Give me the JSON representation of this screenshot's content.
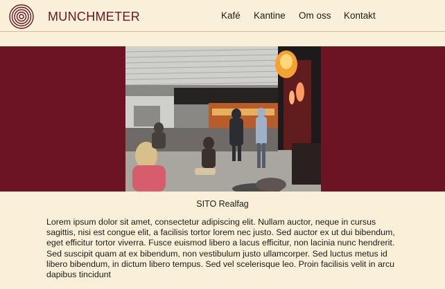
{
  "header": {
    "logo_icon": "concentric-circles-logo",
    "brand": "MUNCHMETER",
    "nav": [
      "Kafé",
      "Kantine",
      "Om oss",
      "Kontakt"
    ]
  },
  "hero": {
    "image_icon": "cafeteria-photo"
  },
  "content": {
    "caption": "SITO Realfag",
    "paragraph": "Lorem ipsum dolor sit amet, consectetur adipiscing elit. Nullam auctor, neque in cursus sagittis, nisi est congue elit, a facilisis tortor lorem nec justo. Sed auctor ex ut dui bibendum, eget efficitur tortor viverra. Fusce euismod libero a lacus efficitur, non lacinia nunc hendrerit. Sed suscipit quam at ex bibendum, non vestibulum justo ullamcorper. Sed luctus metus id libero bibendum, in dictum libero tempus. Sed vel scelerisque leo. Proin facilisis velit in arcu dapibus tincidunt"
  },
  "colors": {
    "background": "#faf0d7",
    "brand": "#6d1424",
    "hero_band": "#6c1424"
  }
}
